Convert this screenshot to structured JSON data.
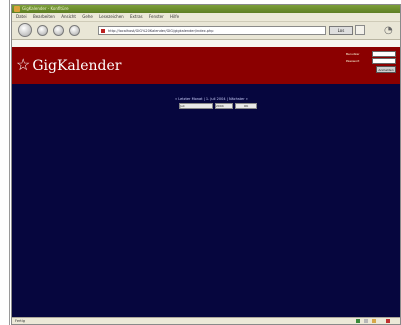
{
  "window": {
    "title": "GigKalender - Konfitüre"
  },
  "menu": [
    "Datei",
    "Bearbeiten",
    "Ansicht",
    "Gehe",
    "Lesezeichen",
    "Extras",
    "Fenster",
    "Hilfe"
  ],
  "toolbar": {
    "url": "http://localhost/GIG%20Kalender/GIG/gigkalender/index.php",
    "go_label": "Los"
  },
  "header": {
    "logo_text": "GigKalender",
    "login": {
      "user_label": "Benutzer",
      "pass_label": "Passwort",
      "button_label": "Anmelden"
    }
  },
  "content": {
    "date_nav": "« Letzter Monat  |  1. Juli 2004  |  Nächster »",
    "form": {
      "month": "Juli",
      "year": "2004",
      "button": "OK"
    }
  },
  "status": {
    "text": "Fertig"
  },
  "colors": {
    "header": "#8b0000",
    "content": "#06063e"
  }
}
